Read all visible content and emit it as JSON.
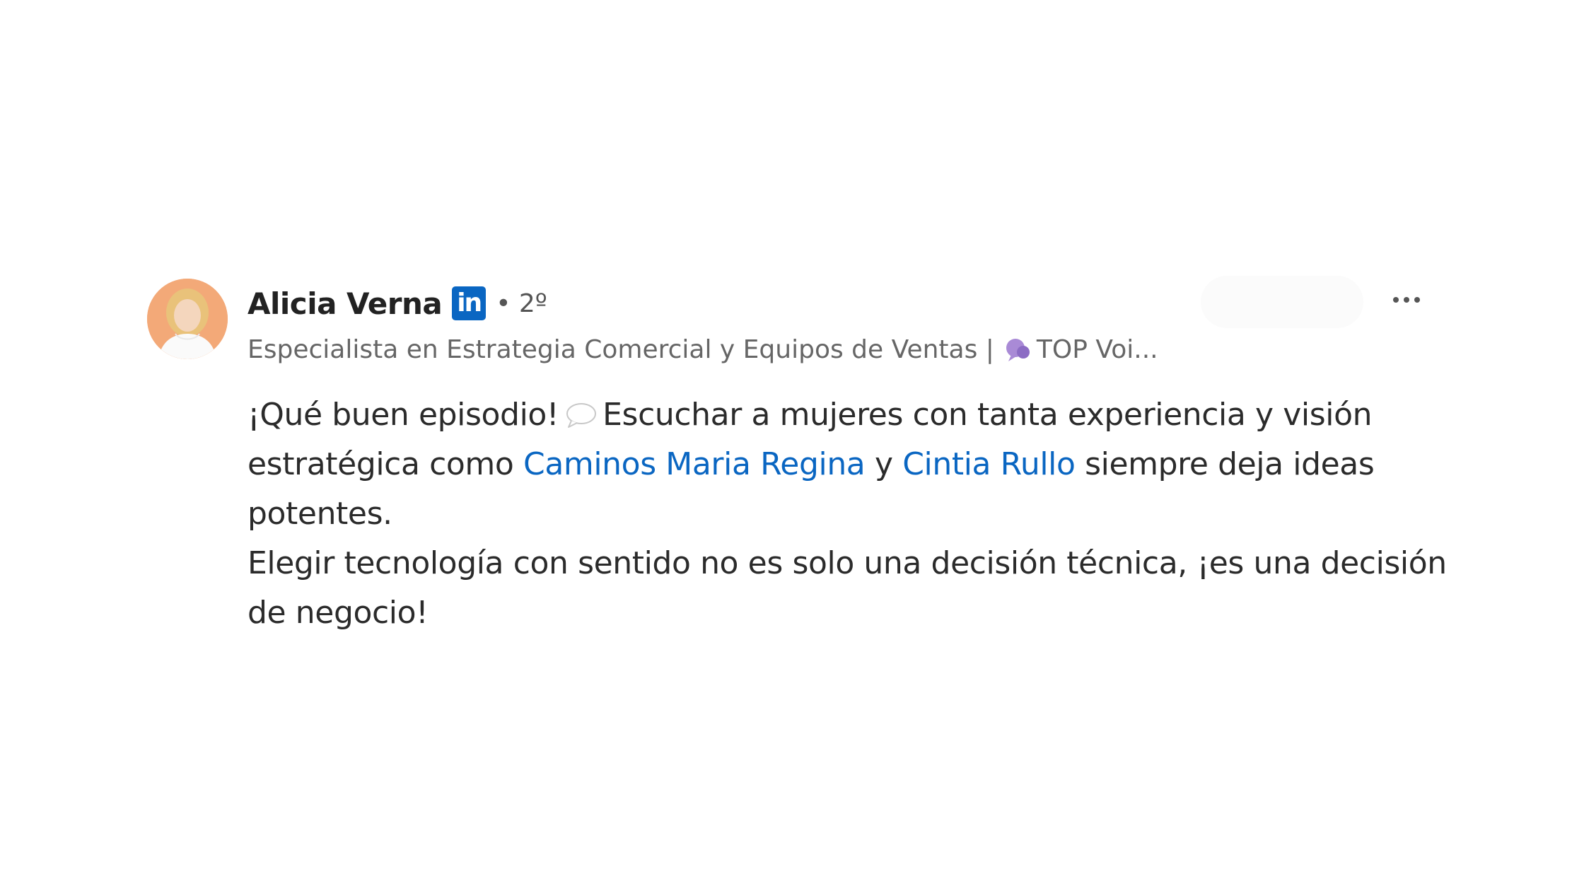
{
  "author": {
    "name": "Alicia Verna",
    "badge_text": "in",
    "degree": "• 2º",
    "headline": "Especialista en Estrategia Comercial y Equipos de Ventas |",
    "headline_suffix": "TOP Voi..."
  },
  "icons": {
    "badge": "linkedin-icon",
    "voice": "top-voice-icon",
    "more": "more-options-icon",
    "chat": "speech-bubble-icon"
  },
  "comment": {
    "part1": "¡Qué buen episodio!",
    "part2": "Escuchar a mujeres con tanta experiencia y visión estratégica como",
    "mention1": "Caminos Maria Regina",
    "connector": "y",
    "mention2": "Cintia Rullo",
    "part3": "siempre deja ideas potentes.",
    "line2": "Elegir tecnología con sentido no es solo una decisión técnica, ¡es una decisión de negocio!"
  },
  "colors": {
    "link": "#0a66c2",
    "badge": "#0a66c2",
    "text": "#2b2b2b",
    "muted": "#666666"
  }
}
